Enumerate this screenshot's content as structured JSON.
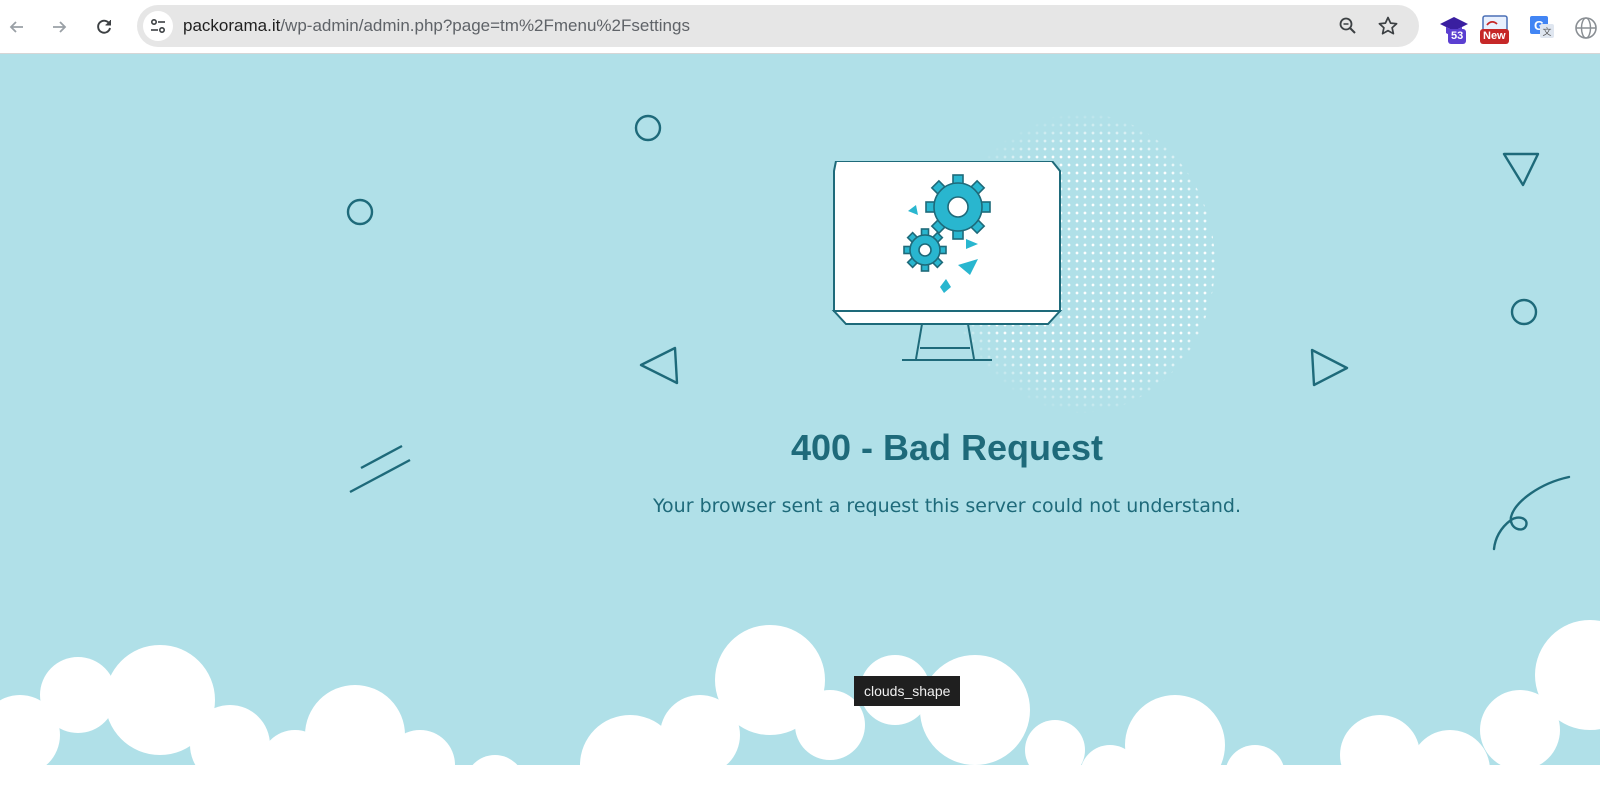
{
  "browser": {
    "url_domain": "packorama.it",
    "url_path": "/wp-admin/admin.php?page=tm%2Fmenu%2Fsettings",
    "extensions": [
      {
        "name": "graduation-cap-extension",
        "badge": "53",
        "badge_color": "#5b3fd1"
      },
      {
        "name": "new-extension",
        "badge": "New",
        "badge_color": "#c62828"
      },
      {
        "name": "translate-extension"
      },
      {
        "name": "globe-extension"
      }
    ]
  },
  "error": {
    "title": "400 - Bad Request",
    "message": "Your browser sent a request this server could not understand."
  },
  "tooltip": {
    "text": "clouds_shape"
  },
  "colors": {
    "background": "#b0e0e8",
    "accent": "#29b6cf",
    "outline": "#1e6a7a",
    "title": "#1e6a7a"
  },
  "icons": {
    "monitor": "monitor-gears-icon",
    "decorations": [
      "circle-outline",
      "triangle-outline",
      "double-line",
      "swirl"
    ]
  }
}
